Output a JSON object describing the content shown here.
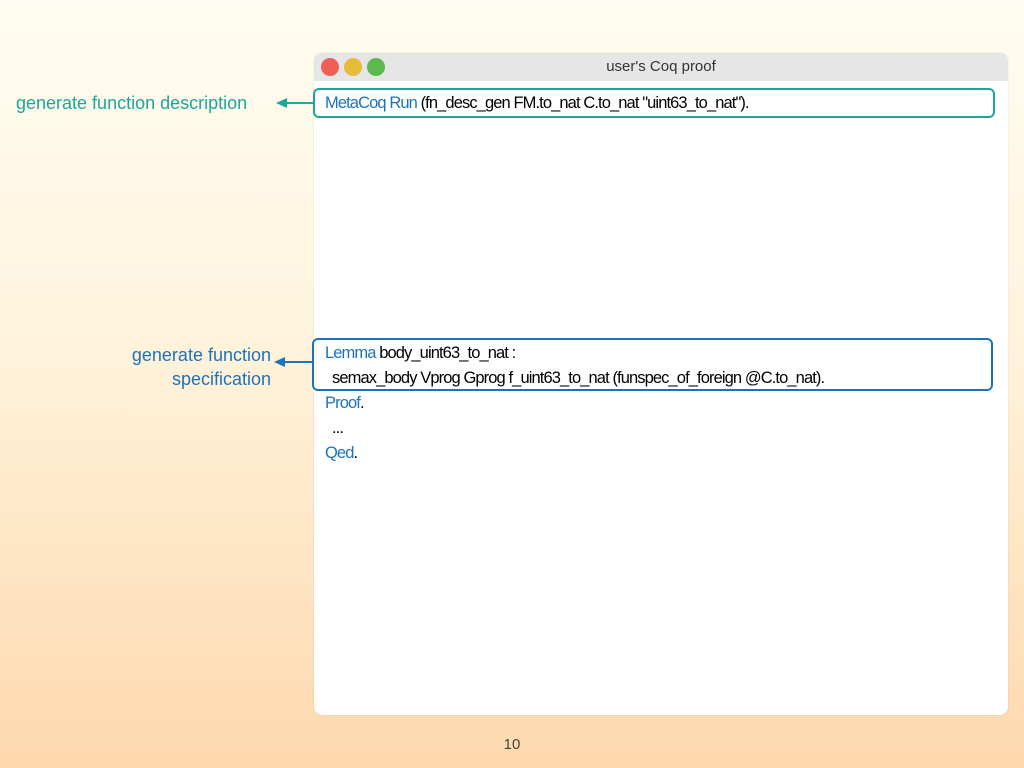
{
  "window": {
    "title": "user's Coq proof"
  },
  "code": {
    "line1": {
      "keyword": "MetaCoq Run",
      "rest": " (fn_desc_gen FM.to_nat C.to_nat \"uint63_to_nat\")."
    },
    "line2": {
      "keyword": "Lemma",
      "rest": " body_uint63_to_nat :"
    },
    "line3": {
      "text": "semax_body Vprog Gprog f_uint63_to_nat (funspec_of_foreign @C.to_nat)."
    },
    "line4": {
      "keyword": "Proof",
      "rest": "."
    },
    "line5": {
      "text": "..."
    },
    "line6": {
      "keyword": "Qed",
      "rest": "."
    }
  },
  "annotations": {
    "description": "generate function description",
    "specification_line1": "generate function",
    "specification_line2": "specification"
  },
  "colors": {
    "teal": "#1aa89c",
    "blue": "#1e73b8"
  },
  "page_number": "10"
}
